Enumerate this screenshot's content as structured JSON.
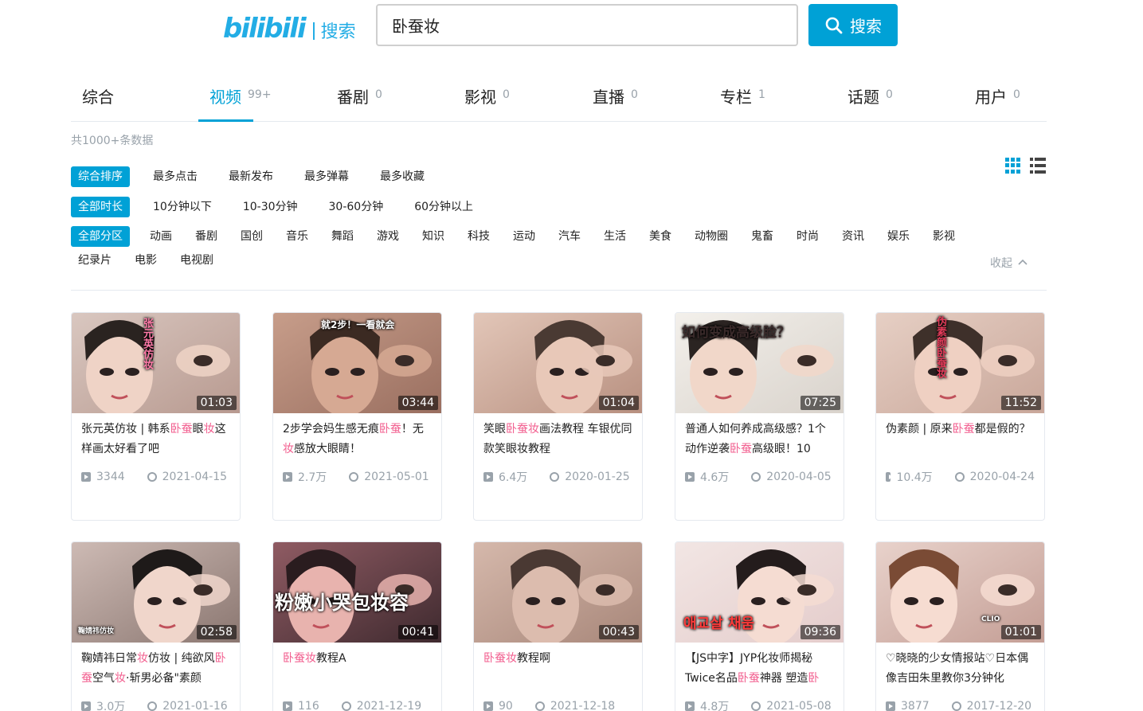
{
  "brand": {
    "logo": "bilibili",
    "search_label": "搜索"
  },
  "search": {
    "value": "卧蚕妆",
    "button_label": "搜索"
  },
  "tabs": [
    {
      "label": "综合",
      "count": ""
    },
    {
      "label": "视频",
      "count": "99+"
    },
    {
      "label": "番剧",
      "count": "0"
    },
    {
      "label": "影视",
      "count": "0"
    },
    {
      "label": "直播",
      "count": "0"
    },
    {
      "label": "专栏",
      "count": "1"
    },
    {
      "label": "话题",
      "count": "0"
    },
    {
      "label": "用户",
      "count": "0"
    }
  ],
  "active_tab": "视频",
  "total": "共1000+条数据",
  "filters": {
    "sort": [
      "综合排序",
      "最多点击",
      "最新发布",
      "最多弹幕",
      "最多收藏"
    ],
    "duration": [
      "全部时长",
      "10分钟以下",
      "10-30分钟",
      "30-60分钟",
      "60分钟以上"
    ],
    "zones_row1": [
      "全部分区",
      "动画",
      "番剧",
      "国创",
      "音乐",
      "舞蹈",
      "游戏",
      "知识",
      "科技",
      "运动",
      "汽车",
      "生活",
      "美食",
      "动物圈",
      "鬼畜",
      "时尚",
      "资讯",
      "娱乐",
      "影视"
    ],
    "zones_row2": [
      "纪录片",
      "电影",
      "电视剧"
    ],
    "collapse_label": "收起"
  },
  "colors": {
    "accent": "#00a1d6",
    "highlight": "#f25d8e",
    "muted": "#99a2aa"
  },
  "icons": {
    "search": "magnifier-icon",
    "grid_view": "grid-view-icon",
    "list_view": "list-view-icon",
    "plays": "play-count-icon",
    "date": "clock-icon"
  },
  "videos": [
    {
      "title_parts": [
        {
          "t": "张元英仿妆 | 韩系"
        },
        {
          "t": "卧蚕",
          "hl": true
        },
        {
          "t": "眼"
        },
        {
          "t": "妆",
          "hl": true
        },
        {
          "t": "这样画太好看了吧"
        }
      ],
      "plays": "3344",
      "date": "2021-04-15",
      "duration": "01:03",
      "thumb_text": "张元英仿妆"
    },
    {
      "title_parts": [
        {
          "t": "2步学会妈生感无痕"
        },
        {
          "t": "卧蚕",
          "hl": true
        },
        {
          "t": "！无"
        },
        {
          "t": "妆",
          "hl": true
        },
        {
          "t": "感放大眼睛！"
        }
      ],
      "plays": "2.7万",
      "date": "2021-05-01",
      "duration": "03:44",
      "thumb_text": "就2步！一看就会"
    },
    {
      "title_parts": [
        {
          "t": "笑眼"
        },
        {
          "t": "卧蚕妆",
          "hl": true
        },
        {
          "t": "画法教程 车银优同款笑眼妆教程"
        }
      ],
      "plays": "6.4万",
      "date": "2020-01-25",
      "duration": "01:04",
      "thumb_text": ""
    },
    {
      "title_parts": [
        {
          "t": "普通人如何养成高级感？1个动作逆袭"
        },
        {
          "t": "卧蚕",
          "hl": true
        },
        {
          "t": "高级眼！10"
        }
      ],
      "plays": "4.6万",
      "date": "2020-04-05",
      "duration": "07:25",
      "thumb_text": "如何变成高级脸？"
    },
    {
      "title_parts": [
        {
          "t": "伪素颜 | 原来"
        },
        {
          "t": "卧蚕",
          "hl": true
        },
        {
          "t": "都是假的？"
        }
      ],
      "plays": "10.4万",
      "date": "2020-04-24",
      "duration": "11:52",
      "thumb_text": "伪素颜卧蚕妆"
    },
    {
      "title_parts": [
        {
          "t": "鞠婧祎日常"
        },
        {
          "t": "妆",
          "hl": true
        },
        {
          "t": "仿妆 | 纯欲风"
        },
        {
          "t": "卧蚕",
          "hl": true
        },
        {
          "t": "空气"
        },
        {
          "t": "妆",
          "hl": true
        },
        {
          "t": "·斩男必备\"素颜"
        }
      ],
      "plays": "3.0万",
      "date": "2021-01-16",
      "duration": "02:58",
      "thumb_text": "鞠婧祎仿妆"
    },
    {
      "title_parts": [
        {
          "t": "卧蚕妆",
          "hl": true
        },
        {
          "t": "教程A"
        }
      ],
      "plays": "116",
      "date": "2021-12-19",
      "duration": "00:41",
      "thumb_text": "粉嫩小哭包妆容"
    },
    {
      "title_parts": [
        {
          "t": "卧蚕妆",
          "hl": true
        },
        {
          "t": "教程啊"
        }
      ],
      "plays": "90",
      "date": "2021-12-18",
      "duration": "00:43",
      "thumb_text": ""
    },
    {
      "title_parts": [
        {
          "t": "【JS中字】JYP化妆师揭秘Twice名品"
        },
        {
          "t": "卧蚕",
          "hl": true
        },
        {
          "t": "神器 塑造"
        },
        {
          "t": "卧",
          "hl": true
        }
      ],
      "plays": "4.8万",
      "date": "2021-05-08",
      "duration": "09:36",
      "thumb_text": "애교살 채움"
    },
    {
      "title_parts": [
        {
          "t": "♡晓晓的少女情报站♡日本偶像吉田朱里教你3分钟化"
        }
      ],
      "plays": "3877",
      "date": "2017-12-20",
      "duration": "01:01",
      "thumb_text": "CLIO"
    }
  ]
}
